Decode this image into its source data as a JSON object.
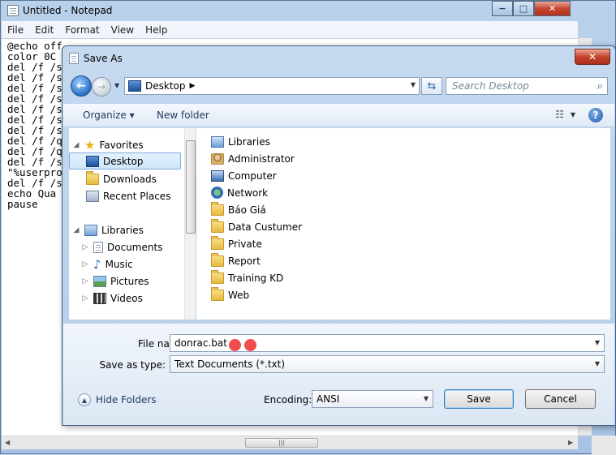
{
  "notepad": {
    "title": "Untitled - Notepad",
    "menu": [
      "File",
      "Edit",
      "Format",
      "View",
      "Help"
    ],
    "text": "@echo off\ncolor 0C\ndel /f /s\ndel /f /s\ndel /f /s\ndel /f /s\ndel /f /s\ndel /f /s\ndel /f /s\ndel /f /q\ndel /f /q\ndel /f /s\n\"%userpro\ndel /f /s\necho Qua\npause",
    "caption": {
      "minimize": "−",
      "maximize": "□",
      "close": "✕"
    }
  },
  "dialog": {
    "title": "Save As",
    "close_label": "✕",
    "address": "Desktop",
    "search_placeholder": "Search Desktop",
    "toolbar": {
      "organize": "Organize ▾",
      "new_folder": "New folder",
      "help": "?"
    },
    "nav": {
      "favorites": "Favorites",
      "favorites_items": [
        "Desktop",
        "Downloads",
        "Recent Places"
      ],
      "libraries": "Libraries",
      "libraries_items": [
        "Documents",
        "Music",
        "Pictures",
        "Videos"
      ]
    },
    "files": [
      "Libraries",
      "Administrator",
      "Computer",
      "Network",
      "Báo Giá",
      "Data Custumer",
      "Private",
      "Report",
      "Training KD",
      "Web"
    ],
    "file_name_label": "File name:",
    "file_name_value": "donrac.bat",
    "save_type_label": "Save as type:",
    "save_type_value": "Text Documents (*.txt)",
    "encoding_label": "Encoding:",
    "encoding_value": "ANSI",
    "hide_folders": "Hide Folders",
    "save_button": "Save",
    "cancel_button": "Cancel"
  }
}
